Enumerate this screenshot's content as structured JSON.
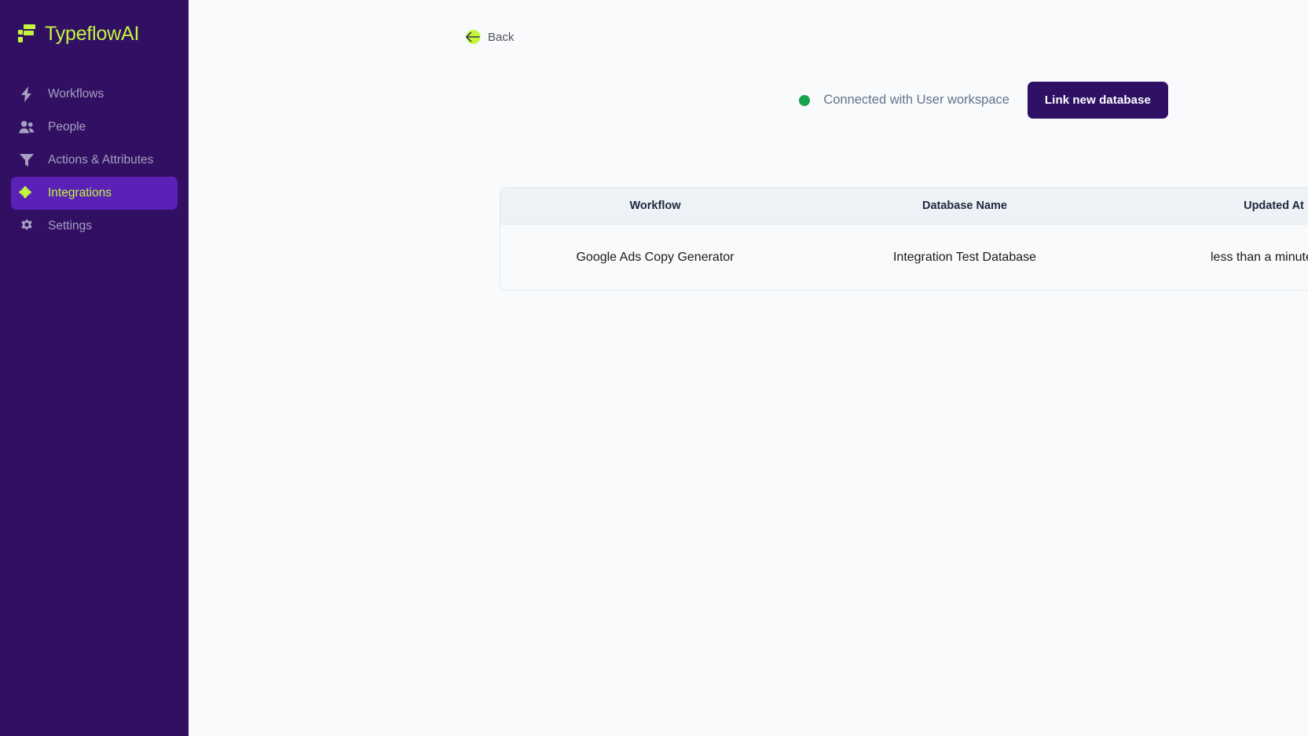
{
  "sidebar": {
    "logo": {
      "text": "TypeflowAI",
      "mark_icon": "typeflow-logo-mark",
      "color": "#c3f53c"
    },
    "items": [
      {
        "label": "Workflows",
        "icon": "bolt-icon",
        "active": false
      },
      {
        "label": "People",
        "icon": "people-icon",
        "active": false
      },
      {
        "label": "Actions & Attributes",
        "icon": "funnel-icon",
        "active": false
      },
      {
        "label": "Integrations",
        "icon": "puzzle-icon",
        "active": true
      },
      {
        "label": "Settings",
        "icon": "gear-icon",
        "active": false
      }
    ],
    "background": "#311063",
    "active_background": "#5b21b6"
  },
  "main": {
    "back": {
      "label": "Back",
      "icon": "arrow-left-icon"
    },
    "connection": {
      "status_label": "Connected with User workspace",
      "status_color": "#16a34a"
    },
    "link_button": {
      "label": "Link new database",
      "color": "#2e1065"
    },
    "table": {
      "columns": [
        "Workflow",
        "Database Name",
        "Updated At"
      ],
      "rows": [
        {
          "workflow": "Google Ads Copy Generator",
          "database_name": "Integration Test Database",
          "updated_at": "less than a minute ago"
        }
      ]
    }
  }
}
